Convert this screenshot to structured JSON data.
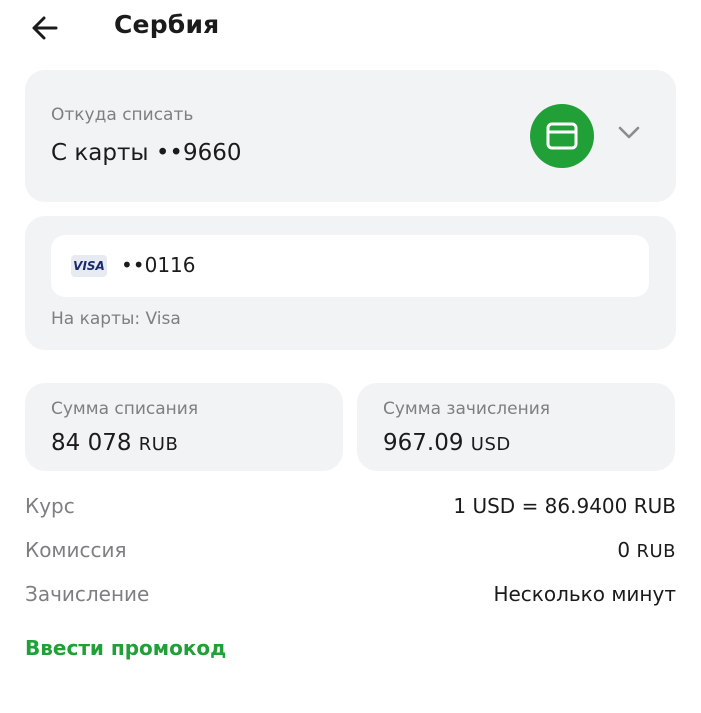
{
  "header": {
    "title": "Сербия",
    "back_icon": "arrow-left-icon"
  },
  "source": {
    "label": "Откуда списать",
    "value": "С карты ••9660",
    "icon": "card-icon",
    "icon_color": "#21a038"
  },
  "destination": {
    "card_brand": "VISA",
    "card_number": "••0116",
    "label": "На карты: Visa"
  },
  "debit": {
    "label": "Сумма списания",
    "amount": "84 078",
    "currency": "RUB"
  },
  "credit": {
    "label": "Сумма зачисления",
    "amount": "967.09",
    "currency": "USD"
  },
  "details": {
    "rate_label": "Курс",
    "rate_value": "1 USD = 86.9400 RUB",
    "fee_label": "Комиссия",
    "fee_amount": "0",
    "fee_currency": "RUB",
    "eta_label": "Зачисление",
    "eta_value": "Несколько минут"
  },
  "promo": {
    "label": "Ввести промокод",
    "color": "#21a038"
  }
}
